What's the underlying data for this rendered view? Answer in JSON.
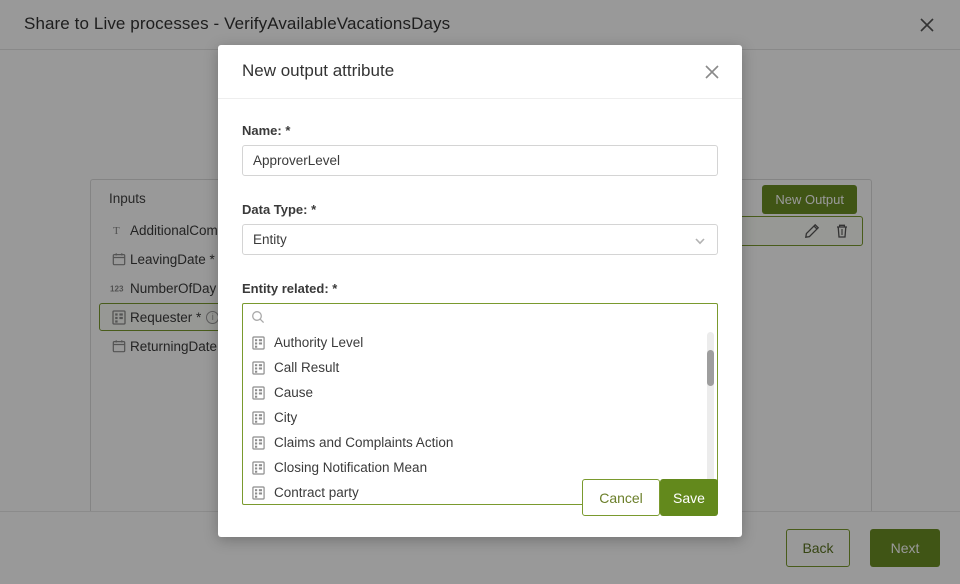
{
  "window": {
    "title": "Share to Live processes - VerifyAvailableVacationsDays",
    "close_icon": "close-icon"
  },
  "workspace": {
    "inputs_header": "Inputs",
    "new_output_label": "New Output",
    "inputs": [
      {
        "icon": "text-icon",
        "glyph": "T",
        "label": "AdditionalCom"
      },
      {
        "icon": "date-icon",
        "glyph": "cal",
        "label": "LeavingDate *"
      },
      {
        "icon": "number-icon",
        "glyph": "123",
        "label": "NumberOfDay"
      },
      {
        "icon": "entity-icon",
        "glyph": "ent",
        "label": "Requester *",
        "selected": true,
        "info": "i"
      },
      {
        "icon": "date-icon",
        "glyph": "cal",
        "label": "ReturningDate"
      }
    ],
    "outputs": [
      {
        "edit_icon": "pencil-icon",
        "delete_icon": "trash-icon"
      }
    ]
  },
  "footer": {
    "back_label": "Back",
    "next_label": "Next"
  },
  "modal": {
    "title": "New output attribute",
    "close_icon": "close-icon",
    "name_label": "Name: *",
    "name_value": "ApproverLevel",
    "name_placeholder": "",
    "datatype_label": "Data Type: *",
    "datatype_value": "Entity",
    "datatype_chevron": "chevron-down-icon",
    "entity_label": "Entity related: *",
    "search_icon": "search-icon",
    "search_value": "",
    "search_placeholder": "",
    "entity_options": [
      "Authority Level",
      "Call Result",
      "Cause",
      "City",
      "Claims and Complaints Action",
      "Closing Notification Mean",
      "Contract party"
    ],
    "cancel_label": "Cancel",
    "save_label": "Save"
  },
  "colors": {
    "accent_green": "#6b8e23",
    "save_green": "#63891c",
    "border_green": "#7a9a2e",
    "overlay": "rgba(0,0,0,0.40)"
  }
}
